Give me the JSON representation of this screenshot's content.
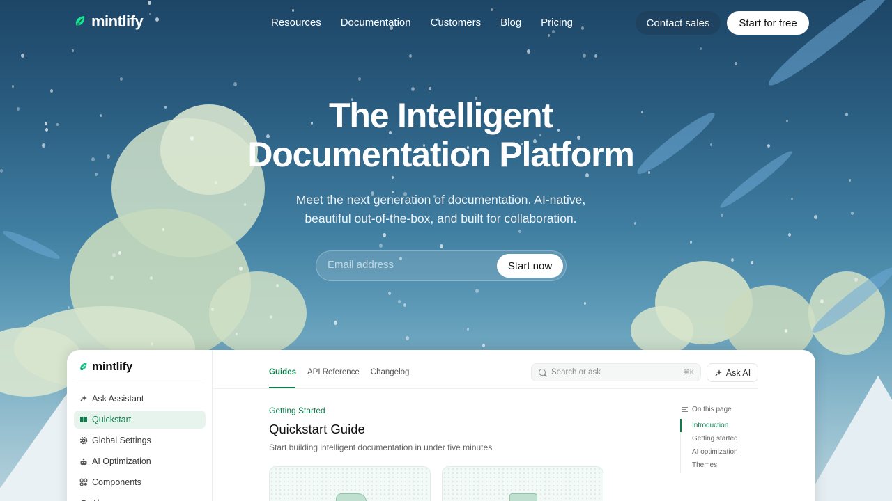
{
  "brand": {
    "name": "mintlify",
    "accent": "#0f7a4a"
  },
  "nav": {
    "links": [
      "Resources",
      "Documentation",
      "Customers",
      "Blog",
      "Pricing"
    ],
    "contact_label": "Contact sales",
    "start_label": "Start for free"
  },
  "hero": {
    "title_line1": "The Intelligent",
    "title_line2": "Documentation Platform",
    "subtitle_line1": "Meet the next generation of documentation. AI-native,",
    "subtitle_line2": "beautiful out-of-the-box, and built for collaboration.",
    "email_placeholder": "Email address",
    "cta_label": "Start now"
  },
  "product": {
    "logo": "mintlify",
    "sidebar": [
      {
        "label": "Ask Assistant",
        "icon": "sparkle-icon",
        "active": false
      },
      {
        "label": "Quickstart",
        "icon": "book-icon",
        "active": true
      },
      {
        "label": "Global Settings",
        "icon": "gear-icon",
        "active": false
      },
      {
        "label": "AI Optimization",
        "icon": "robot-icon",
        "active": false
      },
      {
        "label": "Components",
        "icon": "components-icon",
        "active": false
      },
      {
        "label": "Th",
        "icon": "palette-icon",
        "active": false
      }
    ],
    "tabs": [
      "Guides",
      "API Reference",
      "Changelog"
    ],
    "active_tab": "Guides",
    "search_placeholder": "Search or ask",
    "search_shortcut": "⌘K",
    "ask_ai_label": "Ask AI",
    "breadcrumb": "Getting Started",
    "title": "Quickstart Guide",
    "description": "Start building intelligent documentation in under five minutes",
    "toc_heading": "On this page",
    "toc": [
      "Introduction",
      "Getting started",
      "AI optimization",
      "Themes"
    ],
    "toc_active": "Introduction"
  }
}
